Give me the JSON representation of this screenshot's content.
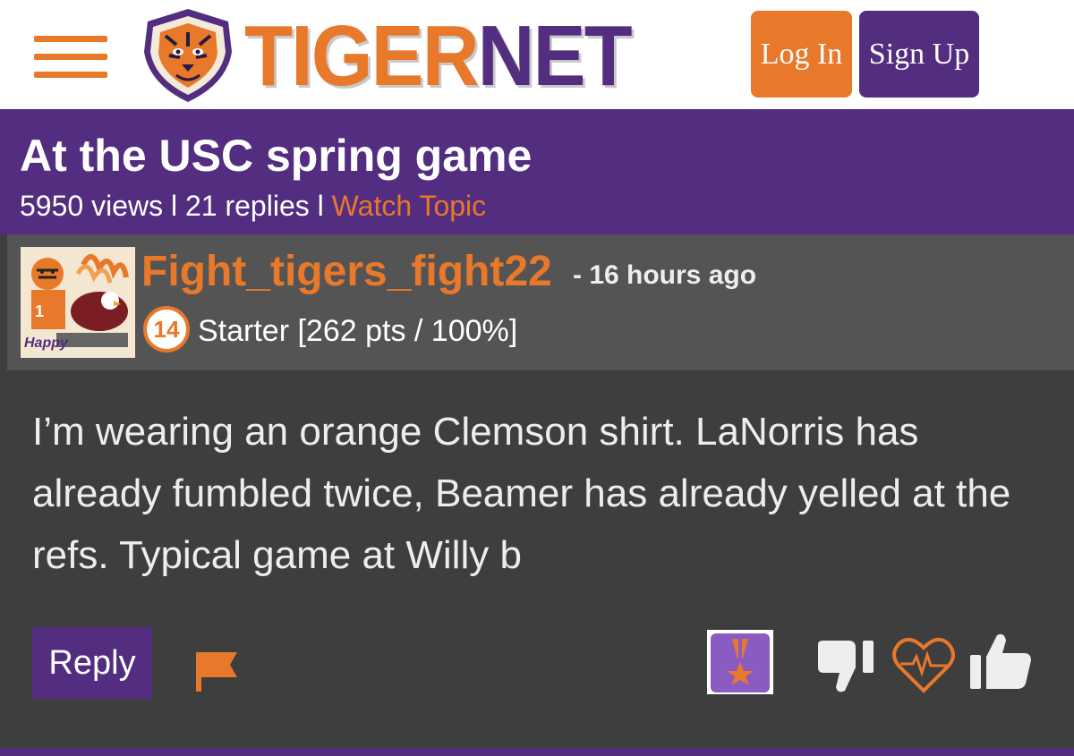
{
  "header": {
    "logo_text_primary": "TIGER",
    "logo_text_secondary": "NET",
    "login_label": "Log In",
    "signup_label": "Sign Up"
  },
  "topic": {
    "title": "At the USC spring game",
    "views": "5950 views",
    "separator": " l ",
    "replies": "21 replies",
    "watch_label": "Watch Topic"
  },
  "post": {
    "username": "Fight_tigers_fight22",
    "time_ago": "- 16 hours ago",
    "rank_number": "14",
    "rank_text": "Starter [262 pts / 100%]",
    "avatar_caption": "Happy",
    "body": "I’m wearing an orange Clemson shirt. LaNorris has already fumbled twice, Beamer has already yelled at the refs. Typical game at Willy b"
  },
  "actions": {
    "reply_label": "Reply",
    "icons": [
      "flag-icon",
      "medal-icon",
      "thumbs-down-icon",
      "heart-icon",
      "thumbs-up-icon"
    ]
  },
  "colors": {
    "orange": "#e8782a",
    "purple": "#522d80",
    "dark_bg": "#3e3e3e",
    "post_header_bg": "#545454"
  }
}
